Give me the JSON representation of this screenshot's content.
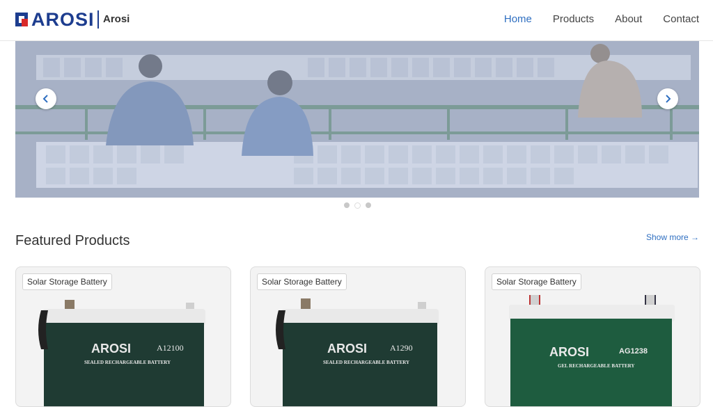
{
  "header": {
    "logo_text": "AROSI",
    "brand_name": "Arosi",
    "nav": [
      {
        "label": "Home",
        "active": true
      },
      {
        "label": "Products",
        "active": false
      },
      {
        "label": "About",
        "active": false
      },
      {
        "label": "Contact",
        "active": false
      }
    ]
  },
  "hero": {
    "slide_count": 3,
    "active_slide": 2,
    "prev_icon": "chevron-left-icon",
    "next_icon": "chevron-right-icon"
  },
  "featured": {
    "title": "Featured Products",
    "show_more": "Show more →",
    "products": [
      {
        "tag": "Solar Storage Battery",
        "brand": "AROSI",
        "model": "A12100",
        "subtitle": "SEALED RECHARGEABLE BATTERY"
      },
      {
        "tag": "Solar Storage Battery",
        "brand": "AROSI",
        "model": "A1290",
        "subtitle": "SEALED RECHARGEABLE BATTERY"
      },
      {
        "tag": "Solar Storage Battery",
        "brand": "AROSI",
        "model": "AG1238",
        "subtitle": "GEL RECHARGEABLE BATTERY"
      }
    ]
  },
  "colors": {
    "accent": "#2f6fc1",
    "logo": "#1d3d8f",
    "battery_body": "#1f3b33"
  }
}
